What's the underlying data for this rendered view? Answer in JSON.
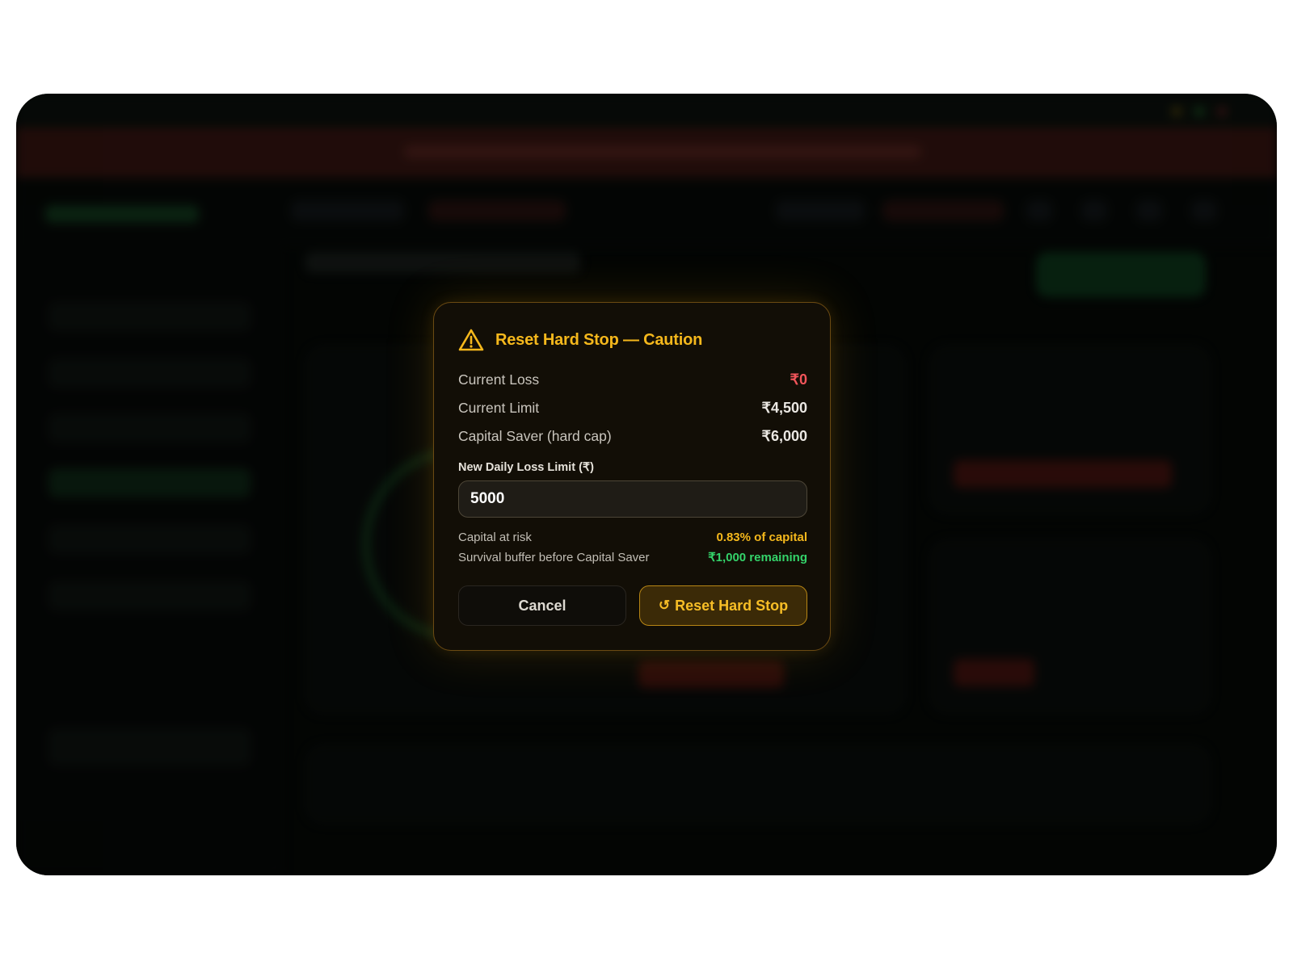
{
  "modal": {
    "title": "Reset Hard Stop — Caution",
    "icon": "warning-triangle-icon",
    "rows": [
      {
        "label": "Current Loss",
        "value": "₹0"
      },
      {
        "label": "Current Limit",
        "value": "₹4,500"
      },
      {
        "label": "Capital Saver (hard cap)",
        "value": "₹6,000"
      }
    ],
    "field_label": "New Daily Loss Limit (₹)",
    "field_value": "5000",
    "stats": [
      {
        "label": "Capital at risk",
        "value": "0.83% of capital"
      },
      {
        "label": "Survival buffer before Capital Saver",
        "value": "₹1,000 remaining"
      }
    ],
    "cancel_label": "Cancel",
    "reset_label": "Reset Hard Stop",
    "reset_icon": "refresh-icon"
  },
  "colors": {
    "accent": "#f5b81c",
    "loss_red": "#f2555a",
    "success_green": "#34d36a",
    "modal_bg": "#120e06"
  }
}
